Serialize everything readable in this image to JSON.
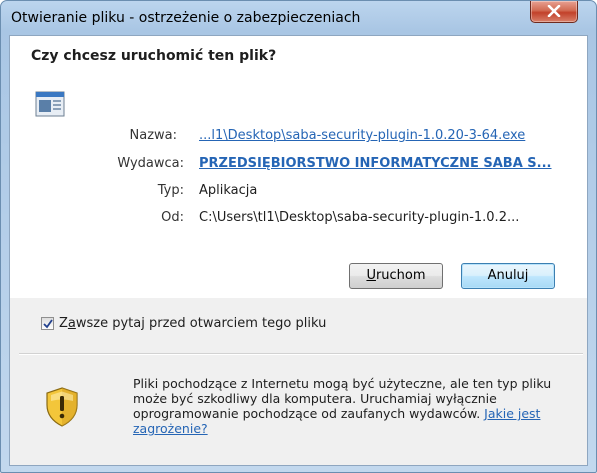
{
  "window": {
    "title": "Otwieranie pliku - ostrzeżenie o zabezpieczeniach"
  },
  "dialog": {
    "heading": "Czy chcesz uruchomić ten plik?",
    "fields": {
      "name_label": "Nazwa:",
      "name_value": "...l1\\Desktop\\saba-security-plugin-1.0.20-3-64.exe",
      "publisher_label": "Wydawca:",
      "publisher_value": "PRZEDSIĘBIORSTWO INFORMATYCZNE SABA S...",
      "type_label": "Typ:",
      "type_value": "Aplikacja",
      "from_label": "Od:",
      "from_value": "C:\\Users\\tl1\\Desktop\\saba-security-plugin-1.0.2..."
    },
    "buttons": {
      "run_mnemonic": "U",
      "run_rest": "ruchom",
      "cancel": "Anuluj"
    },
    "checkbox": {
      "label_first": "Z",
      "label_mnemonic": "a",
      "label_rest": "wsze pytaj przed otwarciem tego pliku",
      "checked": true
    },
    "warning": {
      "text": "Pliki pochodzące z Internetu mogą być użyteczne, ale ten typ pliku może być szkodliwy dla komputera. Uruchamiaj wyłącznie oprogramowanie pochodzące od zaufanych wydawców.",
      "link": "Jakie jest zagrożenie?"
    }
  },
  "colors": {
    "link": "#2565b5",
    "close_button": "#c2412a",
    "frame": "#a9c6e4"
  },
  "icons": {
    "file": "application-file-icon",
    "warning": "security-shield-icon",
    "close": "close-icon"
  }
}
